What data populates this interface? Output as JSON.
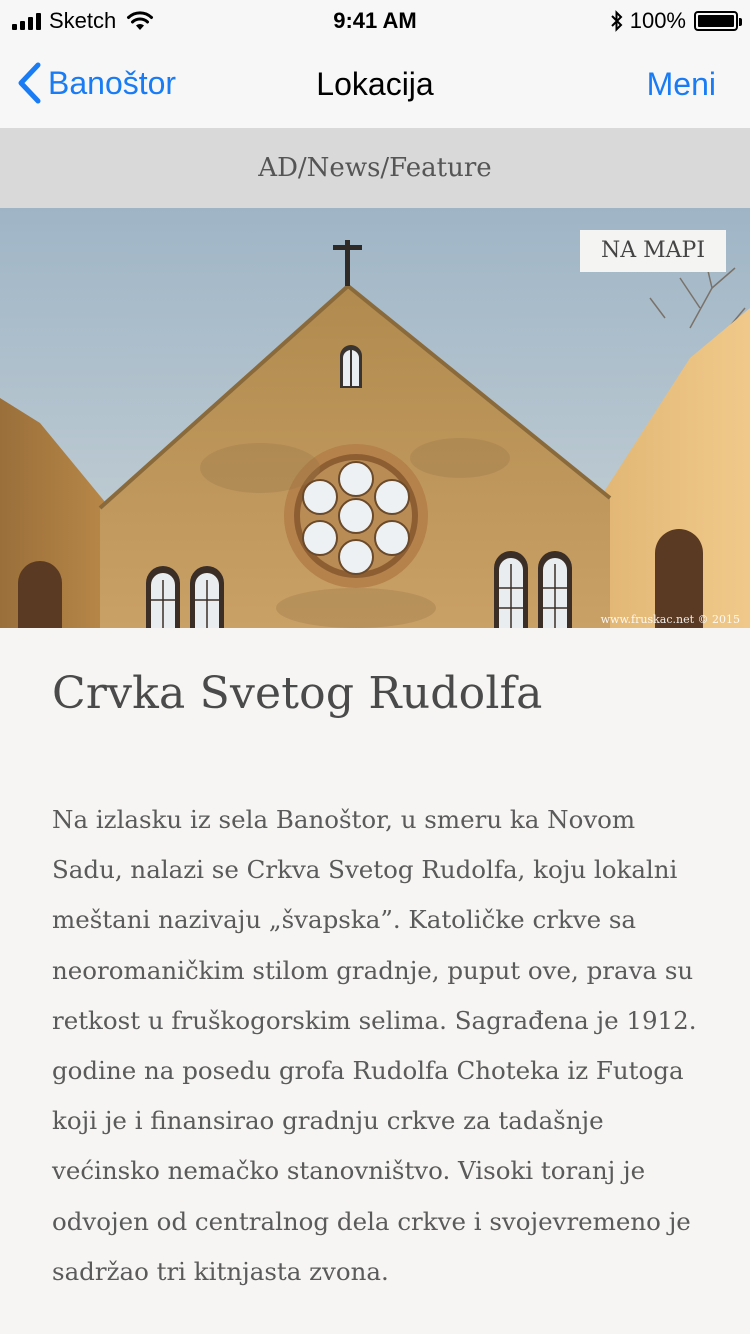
{
  "status_bar": {
    "carrier": "Sketch",
    "time": "9:41 AM",
    "battery": "100%"
  },
  "nav": {
    "back_label": "Banoštor",
    "title": "Lokacija",
    "menu_label": "Meni"
  },
  "ad": {
    "label": "AD/News/Feature"
  },
  "hero": {
    "map_button": "NA MAPI",
    "credit": "www.fruskac.net © 2015"
  },
  "article": {
    "title": "Crvka Svetog Rudolfa",
    "body": "Na izlasku iz sela Banoštor, u smeru ka Novom Sadu, nalazi se Crkva Svetog Rudolfa, koju lokalni meštani nazivaju „švapska”. Katoličke crkve sa neoromaničkim stilom gradnje, puput ove, prava su retkost u fruškogorskim selima. Sagrađena je 1912. godine na posedu grofa Rudolfa Choteka iz Futoga koji je i finansirao gradnju crkve za tadašnje većinsko nemačko stanovništvo. Visoki toranj je odvojen od centralnog dela crkve i svojevremeno je sadržao tri kitnjasta zvona."
  },
  "colors": {
    "accent": "#1a7cf4",
    "background": "#f6f5f3",
    "ad_background": "#d9d9d9"
  }
}
